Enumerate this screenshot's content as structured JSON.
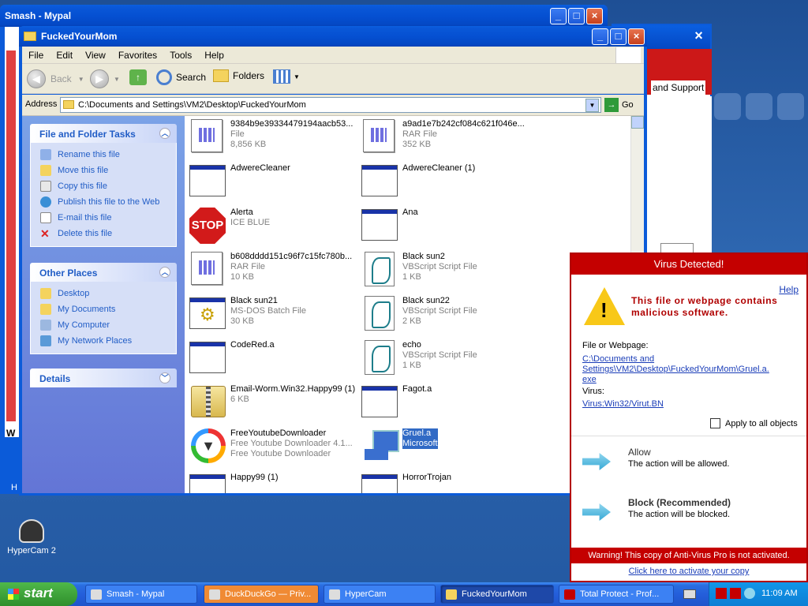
{
  "smash_window": {
    "title": "Smash - Mypal",
    "edge_text": "W",
    "marker": "H"
  },
  "back_window": {
    "support_text": "and Support"
  },
  "explorer": {
    "title": "FuckedYourMom",
    "menu": [
      "File",
      "Edit",
      "View",
      "Favorites",
      "Tools",
      "Help"
    ],
    "toolbar": {
      "back": "Back",
      "search": "Search",
      "folders": "Folders"
    },
    "address_label": "Address",
    "address_value": "C:\\Documents and Settings\\VM2\\Desktop\\FuckedYourMom",
    "go_label": "Go",
    "tasks_panel": {
      "title": "File and Folder Tasks",
      "items": [
        "Rename this file",
        "Move this file",
        "Copy this file",
        "Publish this file to the Web",
        "E-mail this file",
        "Delete this file"
      ]
    },
    "other_places": {
      "title": "Other Places",
      "items": [
        "Desktop",
        "My Documents",
        "My Computer",
        "My Network Places"
      ]
    },
    "details": {
      "title": "Details"
    },
    "files": [
      {
        "name": "9384b9e39334479194aacb53...",
        "type": "File",
        "size": "8,856 KB",
        "icon": "document-icon"
      },
      {
        "name": "a9ad1e7b242cf084c621f046e...",
        "type": "RAR File",
        "size": "352 KB",
        "icon": "document-icon"
      },
      {
        "name": "AdwereCleaner",
        "type": "",
        "size": "",
        "icon": "application-icon"
      },
      {
        "name": "AdwereCleaner (1)",
        "type": "",
        "size": "",
        "icon": "application-icon"
      },
      {
        "name": "Alerta",
        "type": "ICE BLUE",
        "size": "",
        "icon": "stop-sign-icon"
      },
      {
        "name": "Ana",
        "type": "",
        "size": "",
        "icon": "application-icon"
      },
      {
        "name": "b608dddd151c96f7c15fc780b...",
        "type": "RAR File",
        "size": "10 KB",
        "icon": "document-icon"
      },
      {
        "name": "Black sun2",
        "type": "VBScript Script File",
        "size": "1 KB",
        "icon": "script-icon"
      },
      {
        "name": "Black sun21",
        "type": "MS-DOS Batch File",
        "size": "30 KB",
        "icon": "batch-file-icon"
      },
      {
        "name": "Black sun22",
        "type": "VBScript Script File",
        "size": "2 KB",
        "icon": "script-icon"
      },
      {
        "name": "CodeRed.a",
        "type": "",
        "size": "",
        "icon": "application-icon"
      },
      {
        "name": "echo",
        "type": "VBScript Script File",
        "size": "1 KB",
        "icon": "script-icon"
      },
      {
        "name": "Email-Worm.Win32.Happy99 (1)",
        "type": "6 KB",
        "size": "",
        "icon": "zip-folder-icon"
      },
      {
        "name": "Fagot.a",
        "type": "",
        "size": "",
        "icon": "application-icon"
      },
      {
        "name": "FreeYoutubeDownloader",
        "type": "Free Youtube Downloader 4.1...",
        "size": "Free Youtube Downloader",
        "icon": "downloader-icon"
      },
      {
        "name": "Gruel.a",
        "type": "Microsoft",
        "size": "",
        "icon": "computer-icon"
      },
      {
        "name": "Happy99 (1)",
        "type": "",
        "size": "",
        "icon": "application-icon"
      },
      {
        "name": "HorrorTrojan",
        "type": "",
        "size": "",
        "icon": "application-icon"
      }
    ]
  },
  "virus_dialog": {
    "title": "Virus Detected!",
    "help": "Help",
    "message": "This file or webpage contains malicious software.",
    "file_label": "File or Webpage:",
    "file_path": "C:\\Documents and Settings\\VM2\\Desktop\\FuckedYourMom\\Gruel.a. exe",
    "virus_label": "Virus:",
    "virus_name": "Virus:Win32/Virut.BN",
    "apply_all": "Apply to all objects",
    "allow_title": "Allow",
    "allow_desc": "The action will be allowed.",
    "block_title": "Block (Recommended)",
    "block_desc": "The action will be blocked.",
    "footer_warning": "Warning! This copy of Anti-Virus Pro is not activated.",
    "activate_link": "Click here to activate your copy"
  },
  "desktop_icons": [
    {
      "label": "HyperCam 2"
    }
  ],
  "taskbar": {
    "start": "start",
    "tasks": [
      "Smash - Mypal",
      "DuckDuckGo — Priv...",
      "HyperCam",
      "FuckedYourMom",
      "Total Protect - Prof..."
    ],
    "clock": "11:09 AM"
  },
  "colors": {
    "xp_blue": "#0b5bd9",
    "alert_red": "#c40000",
    "link_blue": "#1a3db8"
  }
}
